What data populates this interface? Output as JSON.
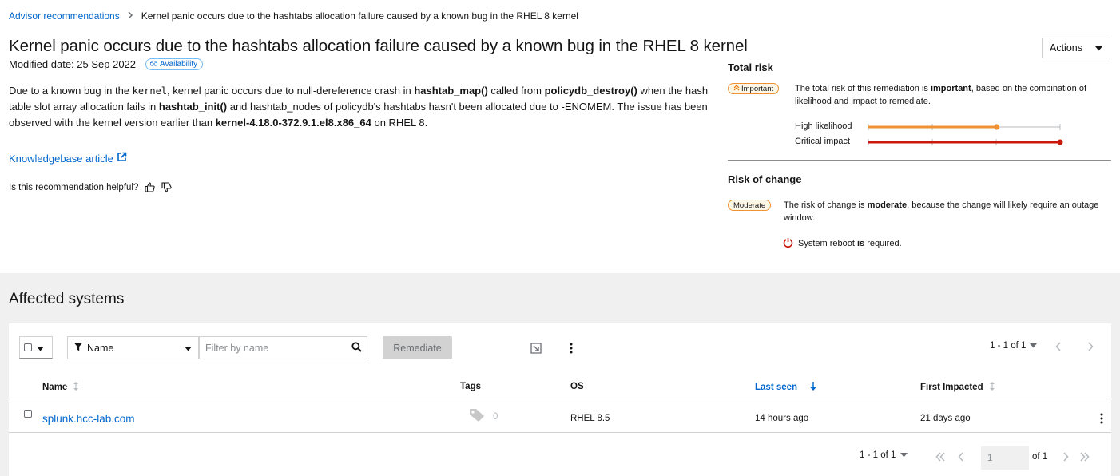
{
  "breadcrumb": {
    "parent": "Advisor recommendations",
    "current": "Kernel panic occurs due to the hashtabs allocation failure caused by a known bug in the RHEL 8 kernel"
  },
  "header": {
    "title": "Kernel panic occurs due to the hashtabs allocation failure caused by a known bug in the RHEL 8 kernel",
    "modified": "Modified date: 25 Sep 2022",
    "category_label": "Availability",
    "actions_label": "Actions"
  },
  "description": {
    "p1": "Due to a known bug in the ",
    "code1": "kernel",
    "p2": ", kernel panic occurs due to null-dereference crash in ",
    "b1": "hashtab_map()",
    "p3": " called from ",
    "b2": "policydb_destroy()",
    "p4": " when the hash table slot array allocation fails in ",
    "b3": "hashtab_init()",
    "p5": " and hashtab_nodes of policydb's hashtabs hasn't been allocated due to -ENOMEM. The issue has been observed with the kernel version earlier than ",
    "b4": "kernel-4.18.0-372.9.1.el8.x86_64",
    "p6": " on RHEL 8."
  },
  "kb_link": "Knowledgebase article",
  "helpful_question": "Is this recommendation helpful?",
  "total_risk": {
    "heading": "Total risk",
    "badge": "Important",
    "text_pre": "The total risk of this remediation is ",
    "text_bold": "important",
    "text_post": ", based on the combination of likelihood and impact to remediate.",
    "likelihood_label": "High likelihood",
    "likelihood_level": 0.67,
    "impact_label": "Critical impact",
    "impact_level": 1.0,
    "likelihood_color": "#ef9234",
    "impact_color": "#c9190b"
  },
  "risk_of_change": {
    "heading": "Risk of change",
    "badge": "Moderate",
    "text_pre": "The risk of change is ",
    "text_bold": "moderate",
    "text_post": ", because the change will likely require an outage window.",
    "reboot_pre": "System reboot",
    "reboot_is": " is",
    "reboot_post": " required."
  },
  "affected": {
    "title": "Affected systems",
    "filter_label": "Name",
    "search_placeholder": "Filter by name",
    "remediate_label": "Remediate",
    "pagination_top": "1 - 1 of 1",
    "columns": [
      "Name",
      "Tags",
      "OS",
      "Last seen",
      "First Impacted"
    ],
    "rows": [
      {
        "name": "splunk.hcc-lab.com",
        "tags": "0",
        "os": "RHEL 8.5",
        "last_seen": "14 hours ago",
        "first_impacted": "21 days ago"
      }
    ],
    "pagination_bottom": "1 - 1 of 1",
    "page_value": "1",
    "page_of": "of 1"
  },
  "icons": [
    "chevron-right-icon",
    "link-icon",
    "external-link-icon",
    "thumbs-up-icon",
    "thumbs-down-icon",
    "caret-down-icon",
    "double-chevron-up-icon",
    "power-icon",
    "filter-icon",
    "search-icon",
    "export-icon",
    "kebab-icon",
    "sort-icon",
    "sort-down-icon",
    "tag-icon",
    "angle-left-icon",
    "angle-right-icon",
    "angle-double-left-icon",
    "angle-double-right-icon"
  ]
}
